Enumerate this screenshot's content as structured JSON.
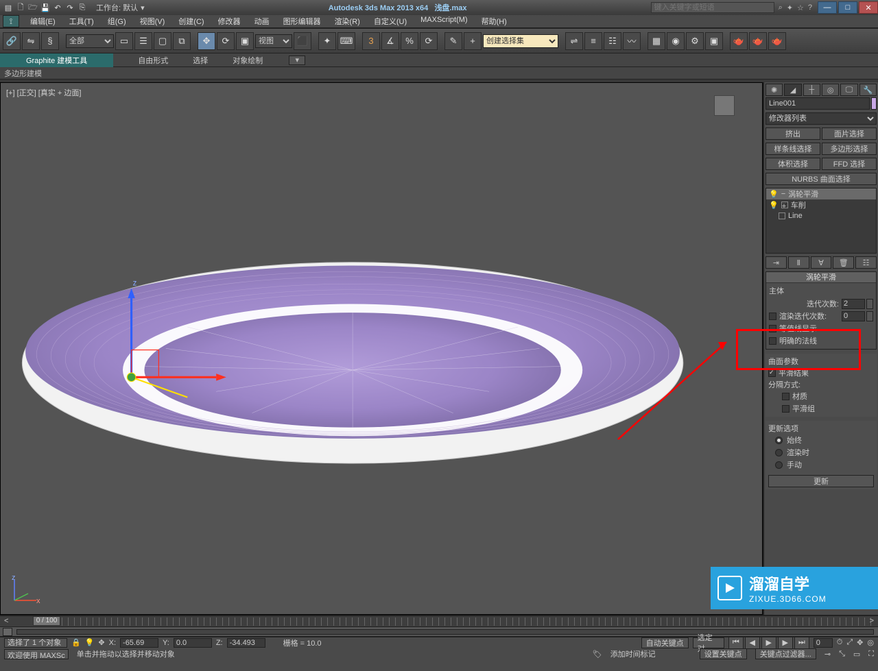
{
  "titlebar": {
    "workspace_label": "工作台: 默认",
    "app_title": "Autodesk 3ds Max  2013 x64",
    "file_name": "浅盘.max",
    "search_placeholder": "键入关键字或短语"
  },
  "menus": [
    "编辑(E)",
    "工具(T)",
    "组(G)",
    "视图(V)",
    "创建(C)",
    "修改器",
    "动画",
    "图形编辑器",
    "渲染(R)",
    "自定义(U)",
    "MAXScript(M)",
    "帮助(H)"
  ],
  "toolbar": {
    "sel_all": "全部",
    "view_mode": "视图",
    "create_set": "创建选择集"
  },
  "graphite": {
    "tab": "Graphite 建模工具",
    "subs": [
      "自由形式",
      "选择",
      "对象绘制"
    ]
  },
  "poly_bar": "多边形建模",
  "viewport": {
    "label": "[+] [正交] [真实 + 边面]"
  },
  "right": {
    "object_name": "Line001",
    "mod_list": "修改器列表",
    "mod_buttons_row1": [
      "挤出",
      "面片选择"
    ],
    "mod_buttons_row2": [
      "样条线选择",
      "多边形选择"
    ],
    "mod_buttons_row3": [
      "体积选择",
      "FFD 选择"
    ],
    "mod_buttons_row4": "NURBS 曲面选择",
    "stack": [
      {
        "icon": "bulb",
        "label": "涡轮平滑",
        "sel": true,
        "exp": "−"
      },
      {
        "icon": "bulb",
        "label": "车削",
        "sel": false,
        "exp": "+",
        "box": true
      },
      {
        "icon": "",
        "label": "Line",
        "sel": false,
        "exp": "",
        "box": true
      }
    ],
    "rollout_turbo": {
      "title": "涡轮平滑",
      "main_label": "主体",
      "iter_label": "迭代次数:",
      "iter_value": "2",
      "render_iter_label": "渲染迭代次数:",
      "render_iter_value": "0",
      "iso_label": "等值线显示",
      "normals_label": "明确的法线"
    },
    "surface_title": "曲面参数",
    "smooth_result": "平滑结果",
    "separate_label": "分隔方式:",
    "sep_material": "材质",
    "sep_smoothgrp": "平滑组",
    "update_title": "更新选项",
    "update_always": "始终",
    "update_render": "渲染时",
    "update_manual": "手动",
    "update_btn": "更新"
  },
  "timeline": {
    "frame_label": "0 / 100"
  },
  "status": {
    "selected": "选择了 1 个对象",
    "hint": "单击并拖动以选择并移动对象",
    "x_label": "X:",
    "x": "-65.69",
    "y_label": "Y:",
    "y": "0.0",
    "z_label": "Z:",
    "z": "-34.493",
    "grid": "栅格 = 10.0",
    "welcome": "欢迎使用 MAXSc",
    "autokey": "自动关键点",
    "selkey": "选定对",
    "setkey": "设置关键点",
    "keyfilter": "关键点过滤器...",
    "add_time_tag": "添加时间标记"
  },
  "watermark": {
    "zh": "溜溜自学",
    "dom": "ZIXUE.3D66.COM"
  }
}
